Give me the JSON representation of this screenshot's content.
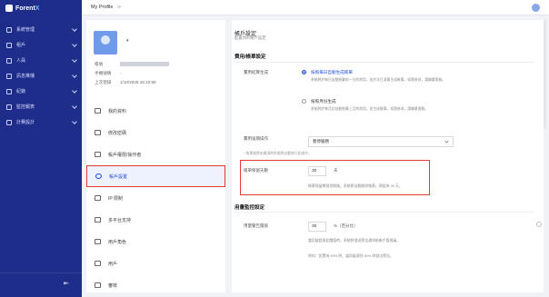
{
  "app": {
    "name_prefix": "Forent",
    "name_suffix": "X"
  },
  "sidebar": {
    "items": [
      {
        "label": "系統管理"
      },
      {
        "label": "租戶"
      },
      {
        "label": "人員"
      },
      {
        "label": "訊息推播"
      },
      {
        "label": "紀錄"
      },
      {
        "label": "監控報表"
      },
      {
        "label": "計費設計"
      }
    ],
    "collapse_glyph": "⇤"
  },
  "topbar": {
    "title": "My Profile",
    "sep": "≫"
  },
  "profile": {
    "caret": "▾",
    "rows": [
      {
        "key": "帳號",
        "value": ""
      },
      {
        "key": "手機號碼",
        "value": "-"
      },
      {
        "key": "上次登錄",
        "value": "1/10/2025 15:10:59"
      }
    ]
  },
  "menu": [
    {
      "label": "我的資料",
      "active": false
    },
    {
      "label": "修改密碼",
      "active": false
    },
    {
      "label": "帳戶權限/操作者",
      "active": false
    },
    {
      "label": "帳戶設置",
      "active": true
    },
    {
      "label": "IP 限制",
      "active": false
    },
    {
      "label": "多平台支持",
      "active": false
    },
    {
      "label": "用戶角色",
      "active": false
    },
    {
      "label": "用戶",
      "active": false
    },
    {
      "label": "審核",
      "active": false
    }
  ],
  "settings": {
    "title": "帳戶設定",
    "subtitle": "配置你的帳戶設定",
    "billing": {
      "section_title": "費用/帳單設定",
      "mode_label": "費用結算生成",
      "options": [
        {
          "title": "按照每日自動生成帳單",
          "desc": "系統將於每日自動結算前一日的費用，並於次日凌晨生成帳單。如需修改，請聯繫客服。"
        },
        {
          "title": "按照月份生成",
          "desc": "系統將於每月初自動結算上月的費用，並生成帳單。如需修改，請聯繫客服。"
        }
      ],
      "overdue_label": "費用逾期操作",
      "overdue_value": "暫停服務",
      "overdue_note": "* 帳單逾期未繳清時系統將自動執行此操作。",
      "days_label": "帳單保留天數",
      "days_value": "30",
      "days_unit": "天",
      "days_hint": "帳單保留期限到期後，系統將自動刪除帳單。預設為 30 天。"
    },
    "monitor": {
      "section_title": "用量監控設定",
      "threshold_label": "用量警告閾值",
      "threshold_value": "30",
      "threshold_unit": "%（百分比）",
      "hint1": "當用量超過此閾值時，系統將發送警告通知給帳戶管理員。",
      "hint2": "例如：設置為 80% 時，當用量達到 80% 時發出警告。"
    }
  }
}
